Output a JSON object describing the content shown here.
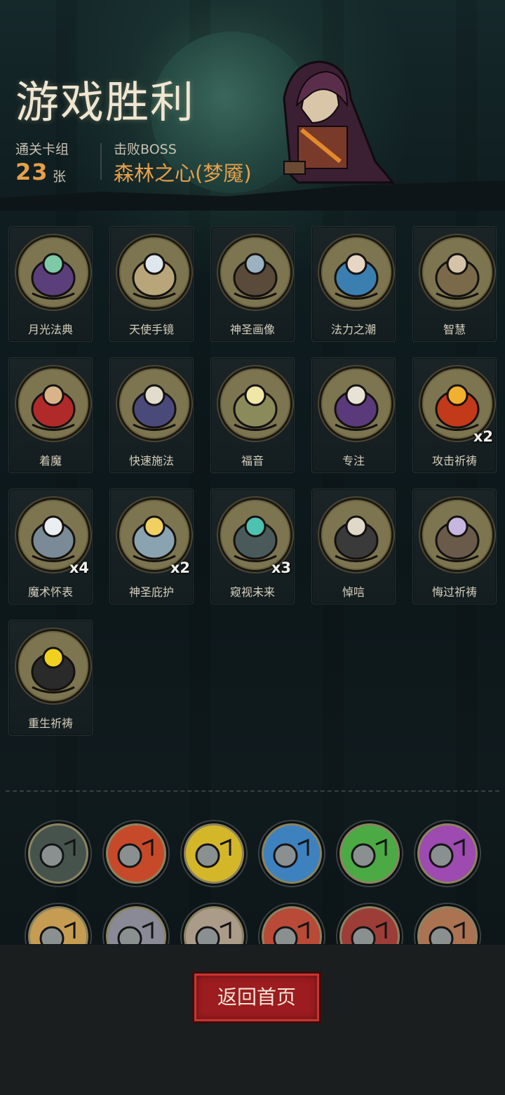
{
  "header": {
    "title": "游戏胜利",
    "deck_label": "通关卡组",
    "deck_count": "23",
    "deck_unit": "张",
    "boss_label": "击败BOSS",
    "boss_name": "森林之心(梦魇)"
  },
  "cards": [
    {
      "name": "月光法典",
      "icon": "moon-tome-icon",
      "multiplier": ""
    },
    {
      "name": "天使手镜",
      "icon": "angel-mirror-icon",
      "multiplier": ""
    },
    {
      "name": "神圣画像",
      "icon": "holy-portrait-icon",
      "multiplier": ""
    },
    {
      "name": "法力之潮",
      "icon": "mana-wave-icon",
      "multiplier": ""
    },
    {
      "name": "智慧",
      "icon": "wise-scholar-icon",
      "multiplier": ""
    },
    {
      "name": "着魔",
      "icon": "possessed-man-icon",
      "multiplier": ""
    },
    {
      "name": "快速施法",
      "icon": "quick-cast-wizard-icon",
      "multiplier": ""
    },
    {
      "name": "福音",
      "icon": "gospel-tombstone-icon",
      "multiplier": ""
    },
    {
      "name": "专注",
      "icon": "focused-wizard-icon",
      "multiplier": ""
    },
    {
      "name": "攻击祈祷",
      "icon": "attack-prayer-fist-icon",
      "multiplier": "x2"
    },
    {
      "name": "魔术怀表",
      "icon": "pocket-watch-icon",
      "multiplier": "x4"
    },
    {
      "name": "神圣庇护",
      "icon": "holy-shield-icon",
      "multiplier": "x2"
    },
    {
      "name": "窥视未来",
      "icon": "future-staff-icon",
      "multiplier": "x3"
    },
    {
      "name": "悼唁",
      "icon": "mourning-nun-icon",
      "multiplier": ""
    },
    {
      "name": "悔过祈祷",
      "icon": "repent-monk-icon",
      "multiplier": ""
    },
    {
      "name": "重生祈祷",
      "icon": "rebirth-prayer-icon",
      "multiplier": ""
    }
  ],
  "relics": [
    {
      "icon": "crescent-moon-relic-icon"
    },
    {
      "icon": "red-flame-skull-relic-icon"
    },
    {
      "icon": "yellow-flame-skull-relic-icon"
    },
    {
      "icon": "blue-flame-skull-relic-icon"
    },
    {
      "icon": "green-flame-skull-relic-icon"
    },
    {
      "icon": "purple-flame-skull-relic-icon"
    },
    {
      "icon": "priest-relic-icon"
    },
    {
      "icon": "swordsman-relic-icon"
    },
    {
      "icon": "old-man-relic-icon"
    },
    {
      "icon": "red-hood-relic-icon"
    },
    {
      "icon": "vampire-relic-icon"
    },
    {
      "icon": "flower-woman-relic-icon"
    }
  ],
  "footer": {
    "home_button": "返回首页"
  },
  "colors": {
    "accent_gold": "#e6a04a",
    "button_red": "#9c1c1f",
    "background": "#0b1417"
  }
}
